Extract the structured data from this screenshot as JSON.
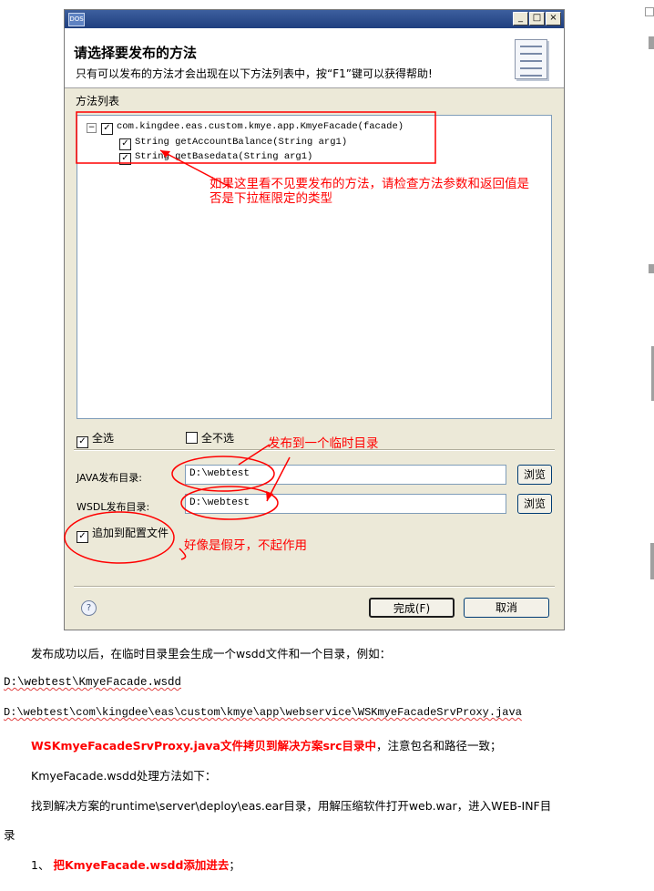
{
  "dialog": {
    "app_icon": "DOS",
    "title_buttons": {
      "minimize": "_",
      "maximize": "□",
      "close": "×"
    },
    "header_title": "请选择要发布的方法",
    "header_subtitle": "只有可以发布的方法才会出现在以下方法列表中，按“F1”键可以获得帮助!",
    "method_list_label": "方法列表",
    "tree": {
      "root_label": "com.kingdee.eas.custom.kmye.app.KmyeFacade(facade)",
      "methods": [
        "String getAccountBalance(String arg1)",
        "String getBasedata(String arg1)"
      ]
    },
    "select_all": "全选",
    "select_none": "全不选",
    "java_dir_label": "JAVA发布目录:",
    "java_dir_value": "D:\\webtest",
    "wsdl_dir_label": "WSDL发布目录:",
    "wsdl_dir_value": "D:\\webtest",
    "browse_label": "浏览",
    "append_config_label": "追加到配置文件",
    "help_glyph": "?",
    "finish_label": "完成(F)",
    "cancel_label": "取消"
  },
  "annotations": {
    "note_methods_line1": "如果这里看不见要发布的方法，请检查方法参数和返回值是",
    "note_methods_line2": "否是下拉框限定的类型",
    "note_tempdir": "发布到一个临时目录",
    "note_config": "好像是假牙，不起作用"
  },
  "document": {
    "line1": "发布成功以后，在临时目录里会生成一个wsdd文件和一个目录，例如：",
    "line2": "D:\\webtest\\KmyeFacade.wsdd",
    "line3": "D:\\webtest\\com\\kingdee\\eas\\custom\\kmye\\app\\webservice\\WSKmyeFacadeSrvProxy.java",
    "line4_red": "WSKmyeFacadeSrvProxy.java文件拷贝到解决方案src目录中",
    "line4_rest": "，注意包名和路径一致；",
    "line5": "KmyeFacade.wsdd处理方法如下：",
    "line6": "找到解决方案的runtime\\server\\deploy\\eas.ear目录，用解压缩软件打开web.war，进入WEB-INF目",
    "line7": "录",
    "line8_prefix": "1、",
    "line8_red": "把KmyeFacade.wsdd添加进去",
    "line8_suffix": "；"
  },
  "colors": {
    "annotation_red": "#ff0000",
    "titlebar": "#2a4a8a",
    "dialog_bg": "#ece9d8"
  }
}
